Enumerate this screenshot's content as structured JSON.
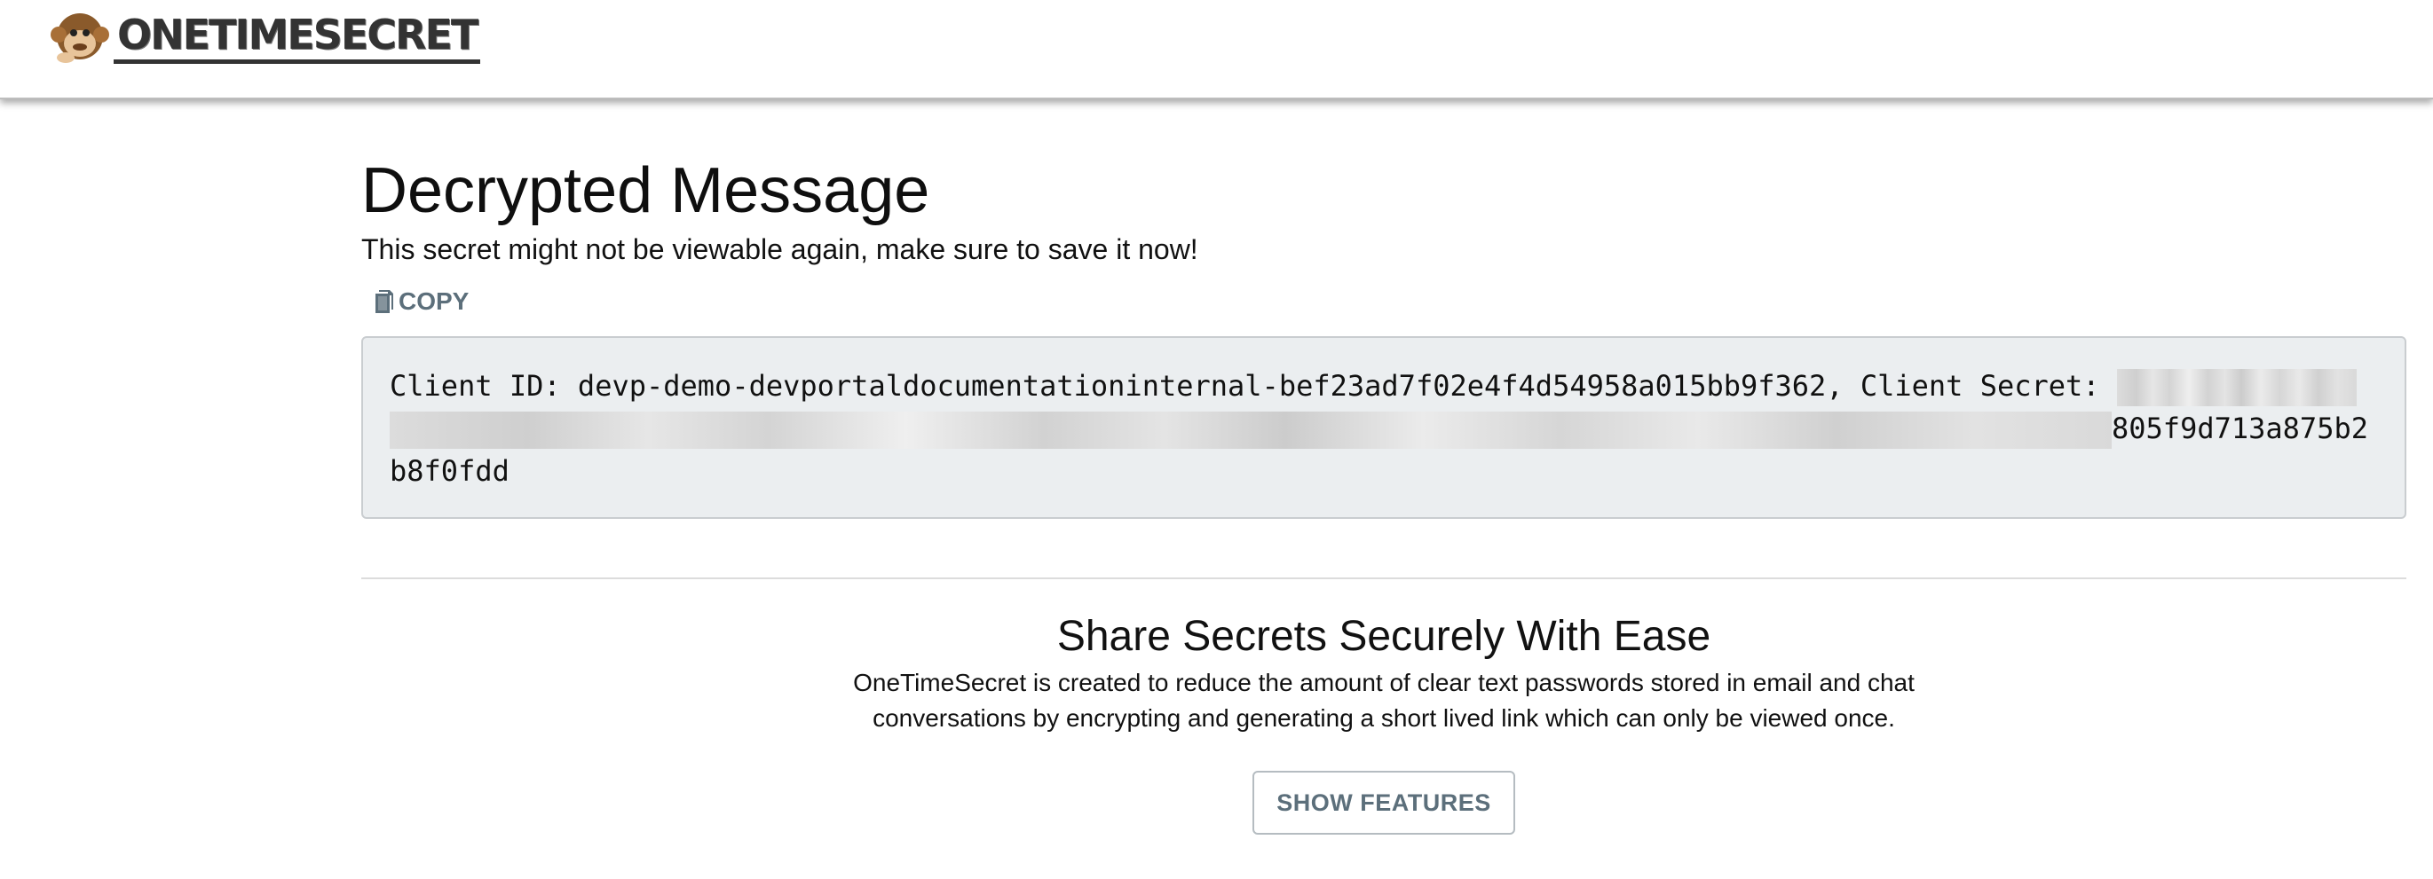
{
  "header": {
    "logo_text": "ONETIMESECRET",
    "logo_icon": "monkey-icon"
  },
  "main": {
    "title": "Decrypted Message",
    "subtitle": "This secret might not be viewable again, make sure to save it now!",
    "copy_label": "COPY",
    "copy_icon": "copy-icon",
    "secret": {
      "prefix": "Client ID: devp-demo-devportaldocumentationinternal-bef23ad7f02e4f4d54958a015bb9f362, Client Secret: ",
      "suffix_line": "805f9d713a875b2",
      "last_line": "b8f0fdd"
    }
  },
  "share": {
    "title": "Share Secrets Securely With Ease",
    "description": "OneTimeSecret is created to reduce the amount of clear text passwords stored in email and chat conversations by encrypting and generating a short lived link which can only be viewed once.",
    "button_label": "SHOW FEATURES"
  },
  "colors": {
    "accent": "#5c6f7b",
    "code_background": "#ebeef0"
  }
}
